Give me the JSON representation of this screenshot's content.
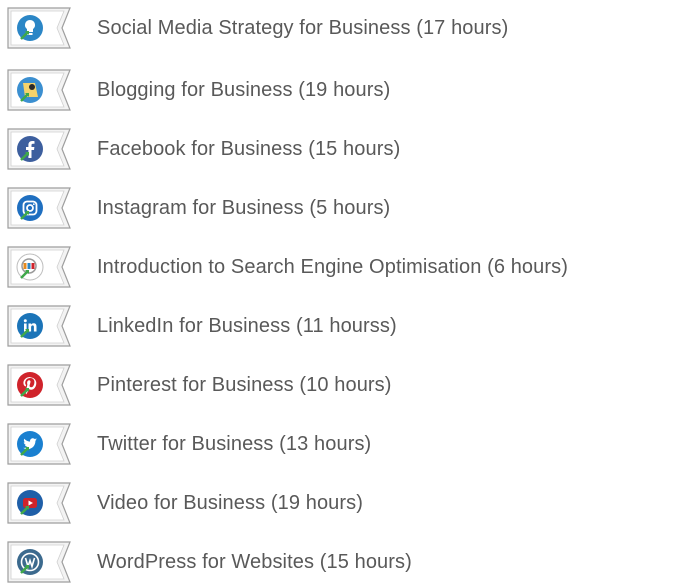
{
  "courses": [
    {
      "label": "Social Media Strategy for Business (17 hours)",
      "icon": "lightbulb-icon",
      "color": "#2b86c6"
    },
    {
      "label": "Blogging for Business (19 hours)",
      "icon": "blogging-person-icon",
      "color": "#3b8fd0"
    },
    {
      "label": "Facebook for Business (15 hours)",
      "icon": "facebook-icon",
      "color": "#3d5f9e"
    },
    {
      "label": "Instagram for Business (5 hours)",
      "icon": "instagram-icon",
      "color": "#1f6fc0"
    },
    {
      "label": "Introduction to Search Engine Optimisation (6 hours)",
      "icon": "seo-magnifier-icon",
      "color": "#e58a1f"
    },
    {
      "label": "LinkedIn for Business (11 hourss)",
      "icon": "linkedin-icon",
      "color": "#1b74b8"
    },
    {
      "label": "Pinterest for Business (10 hours)",
      "icon": "pinterest-icon",
      "color": "#d0232b"
    },
    {
      "label": "Twitter for Business (13 hours)",
      "icon": "twitter-icon",
      "color": "#1a80d0"
    },
    {
      "label": "Video for Business (19 hours)",
      "icon": "youtube-icon",
      "color": "#1f5fa8"
    },
    {
      "label": "WordPress for Websites (15 hours)",
      "icon": "wordpress-icon",
      "color": "#3c6a8e"
    }
  ]
}
